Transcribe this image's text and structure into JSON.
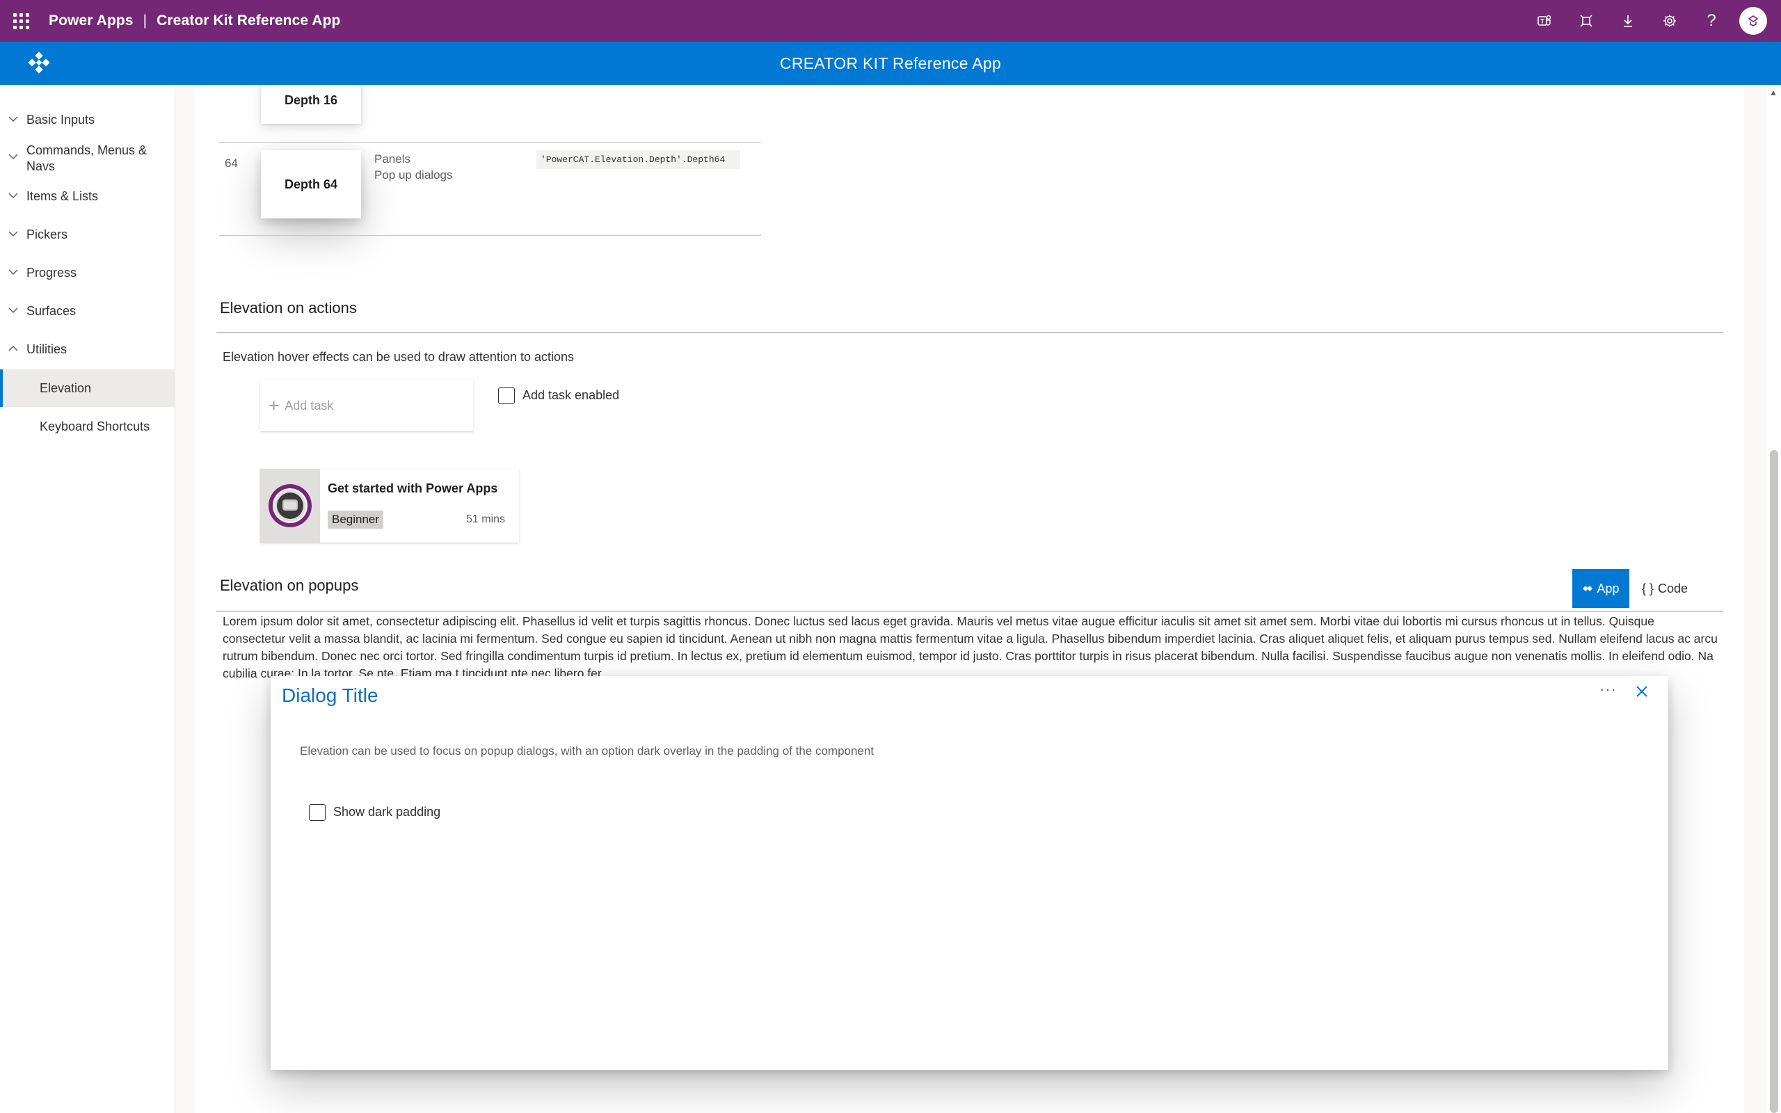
{
  "suitebar": {
    "app_name": "Power Apps",
    "separator": "|",
    "app_title": "Creator Kit Reference App",
    "icons": [
      "teams-icon",
      "fullscreen-icon",
      "download-icon",
      "settings-icon",
      "help-icon"
    ],
    "help_glyph": "?"
  },
  "appbar": {
    "title": "CREATOR KIT Reference App"
  },
  "sidebar": {
    "groups": [
      {
        "label": "Basic Inputs",
        "expanded": false
      },
      {
        "label": "Commands, Menus & Navs",
        "label_line1": "Commands, Menus &",
        "label_line2": "Navs",
        "expanded": false
      },
      {
        "label": "Items & Lists",
        "expanded": false
      },
      {
        "label": "Pickers",
        "expanded": false
      },
      {
        "label": "Progress",
        "expanded": false
      },
      {
        "label": "Surfaces",
        "expanded": false
      },
      {
        "label": "Utilities",
        "expanded": true
      }
    ],
    "subitems": [
      {
        "label": "Elevation",
        "active": true
      },
      {
        "label": "Keyboard Shortcuts",
        "active": false
      }
    ]
  },
  "depth_table": {
    "rows": [
      {
        "depth": "16",
        "card_label": "Depth 16"
      },
      {
        "depth": "64",
        "card_label": "Depth 64",
        "usage_line1": "Panels",
        "usage_line2": "Pop up dialogs",
        "code": "'PowerCAT.Elevation.Depth'.Depth64"
      }
    ]
  },
  "actions_section": {
    "title": "Elevation on actions",
    "description": "Elevation hover effects can be used to draw attention to actions",
    "add_task_label": "Add task",
    "add_task_checkbox_label": "Add task enabled",
    "add_task_enabled": false,
    "course": {
      "title": "Get started with Power Apps",
      "level": "Beginner",
      "duration": "51 mins"
    }
  },
  "popups_section": {
    "title": "Elevation on popups",
    "toggle_app": "App",
    "toggle_code": "Code",
    "selected_view": "App",
    "lorem": "Lorem ipsum dolor sit amet, consectetur adipiscing elit. Phasellus id velit et turpis sagittis rhoncus. Donec luctus sed lacus eget gravida. Mauris vel metus vitae augue efficitur iaculis sit amet sit amet sem. Morbi vitae dui lobortis mi cursus rhoncus ut in tellus. Quisque consectetur velit a massa blandit, ac lacinia mi fermentum. Sed congue eu sapien id tincidunt. Aenean ut nibh non magna mattis fermentum vitae a ligula. Phasellus bibendum imperdiet lacinia. Cras aliquet aliquet felis, et aliquam purus tempus sed. Nullam eleifend lacus ac arcu rutrum bibendum. Donec nec orci tortor. Sed fringilla condimentum turpis id pretium. In lectus ex, pretium id elementum euismod, tempor id justo. Cras porttitor turpis in risus placerat bibendum. Nulla facilisi. Suspendisse faucibus augue non venenatis mollis. In eleifend odio. Na cubilia curae; In la tortor. Se nte. Etiam ma t tincidunt nte nec libero fer"
  },
  "dialog": {
    "title": "Dialog Title",
    "more_glyph": "···",
    "text": "Elevation can be used to focus on popup dialogs, with an option dark overlay in the padding of the component",
    "checkbox_label": "Show dark padding",
    "show_dark_padding": false
  }
}
